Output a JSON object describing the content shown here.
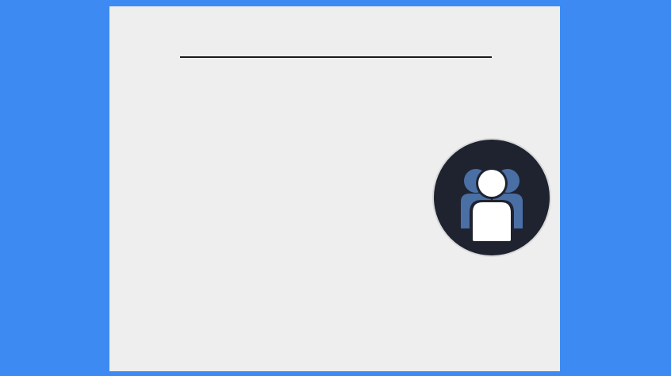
{
  "colors": {
    "background": "#3d8bf2",
    "card": "#eeeeee",
    "divider": "#1a1a1a",
    "avatar_bg": "#1f2330",
    "avatar_secondary": "#4a6fa5",
    "avatar_primary": "#ffffff"
  },
  "icons": {
    "avatar": "users-group-icon"
  }
}
